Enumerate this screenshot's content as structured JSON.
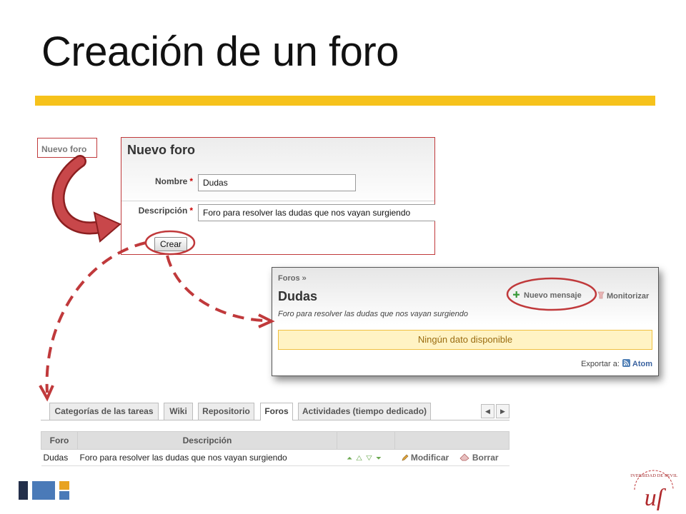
{
  "slide": {
    "title": "Creación de un foro"
  },
  "new_forum_link": {
    "label": "Nuevo foro"
  },
  "new_forum_form": {
    "heading": "Nuevo foro",
    "name_label": "Nombre",
    "name_value": "Dudas",
    "description_label": "Descripción",
    "description_value": "Foro para resolver las dudas que nos vayan surgiendo",
    "required_mark": "*",
    "submit_label": "Crear"
  },
  "forum_page": {
    "breadcrumb": "Foros",
    "breadcrumb_separator": "»",
    "title": "Dudas",
    "description": "Foro para resolver las dudas que nos vayan surgiendo",
    "new_message_label": "Nuevo mensaje",
    "monitor_label": "Monitorizar",
    "empty_message": "Ningún dato disponible",
    "export_label": "Exportar a:",
    "atom_label": "Atom"
  },
  "tabs": [
    {
      "label": "Categorías de las tareas",
      "active": false
    },
    {
      "label": "Wiki",
      "active": false
    },
    {
      "label": "Repositorio",
      "active": false
    },
    {
      "label": "Foros",
      "active": true
    },
    {
      "label": "Actividades (tiempo dedicado)",
      "active": false
    }
  ],
  "forums_table": {
    "headers": [
      "Foro",
      "Descripción",
      "",
      ""
    ],
    "rows": [
      {
        "name": "Dudas",
        "description": "Foro para resolver las dudas que nos vayan surgiendo",
        "edit_label": "Modificar",
        "delete_label": "Borrar"
      }
    ]
  },
  "colors": {
    "accent_bar": "#f6c21b",
    "highlight_red": "#c0393b",
    "empty_notice_bg": "#fff3c4"
  },
  "icons": [
    "arrow-curved-icon",
    "dashed-arrow-icon",
    "add-icon",
    "monitor-icon",
    "rss-icon",
    "move-top-icon",
    "move-up-icon",
    "move-down-icon",
    "move-bottom-icon",
    "edit-icon",
    "delete-icon"
  ]
}
